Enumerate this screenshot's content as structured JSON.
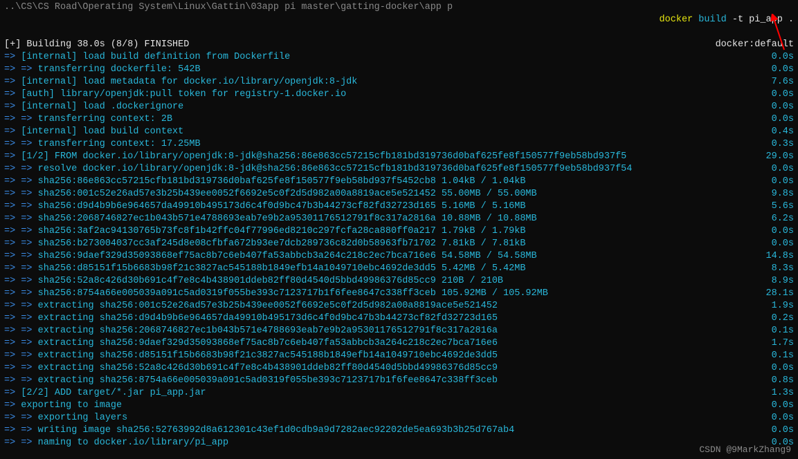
{
  "topbar": {
    "path": "..\\CS\\CS Road\\Operating System\\Linux\\Gattin\\03app pi master\\gatting-docker\\app p",
    "cmd_prefix": " docker ",
    "cmd_build": "build",
    "cmd_suffix": " -t pi_app ."
  },
  "header": {
    "building": "[+] Building 38.0s (8/8) FINISHED",
    "driver": "docker:default"
  },
  "rows": [
    {
      "prefix": "=>",
      "text": " [internal] load build definition from Dockerfile",
      "time": "0.0s"
    },
    {
      "prefix": "=> =>",
      "text": " transferring dockerfile: 542B",
      "time": "0.0s"
    },
    {
      "prefix": "=>",
      "text": " [internal] load metadata for docker.io/library/openjdk:8-jdk",
      "time": "7.6s"
    },
    {
      "prefix": "=>",
      "text": " [auth] library/openjdk:pull token for registry-1.docker.io",
      "time": "0.0s"
    },
    {
      "prefix": "=>",
      "text": " [internal] load .dockerignore",
      "time": "0.0s"
    },
    {
      "prefix": "=> =>",
      "text": " transferring context: 2B",
      "time": "0.0s"
    },
    {
      "prefix": "=>",
      "text": " [internal] load build context",
      "time": "0.4s"
    },
    {
      "prefix": "=> =>",
      "text": " transferring context: 17.25MB",
      "time": "0.3s"
    },
    {
      "prefix": "=>",
      "text": " [1/2] FROM docker.io/library/openjdk:8-jdk@sha256:86e863cc57215cfb181bd319736d0baf625fe8f150577f9eb58bd937f5",
      "time": "29.0s"
    },
    {
      "prefix": "=> =>",
      "text": " resolve docker.io/library/openjdk:8-jdk@sha256:86e863cc57215cfb181bd319736d0baf625fe8f150577f9eb58bd937f54",
      "time": "0.0s"
    },
    {
      "prefix": "=> =>",
      "text": " sha256:86e863cc57215cfb181bd319736d0baf625fe8f150577f9eb58bd937f5452cb8 1.04kB / 1.04kB",
      "time": "0.0s"
    },
    {
      "prefix": "=> =>",
      "text": " sha256:001c52e26ad57e3b25b439ee0052f6692e5c0f2d5d982a00a8819ace5e521452 55.00MB / 55.00MB",
      "time": "9.8s"
    },
    {
      "prefix": "=> =>",
      "text": " sha256:d9d4b9b6e964657da49910b495173d6c4f0d9bc47b3b44273cf82fd32723d165 5.16MB / 5.16MB",
      "time": "5.6s"
    },
    {
      "prefix": "=> =>",
      "text": " sha256:2068746827ec1b043b571e4788693eab7e9b2a95301176512791f8c317a2816a 10.88MB / 10.88MB",
      "time": "6.2s"
    },
    {
      "prefix": "=> =>",
      "text": " sha256:3af2ac94130765b73fc8f1b42ffc04f77996ed8210c297fcfa28ca880ff0a217 1.79kB / 1.79kB",
      "time": "0.0s"
    },
    {
      "prefix": "=> =>",
      "text": " sha256:b273004037cc3af245d8e08cfbfa672b93ee7dcb289736c82d0b58963fb71702 7.81kB / 7.81kB",
      "time": "0.0s"
    },
    {
      "prefix": "=> =>",
      "text": " sha256:9daef329d35093868ef75ac8b7c6eb407fa53abbcb3a264c218c2ec7bca716e6 54.58MB / 54.58MB",
      "time": "14.8s"
    },
    {
      "prefix": "=> =>",
      "text": " sha256:d85151f15b6683b98f21c3827ac545188b1849efb14a1049710ebc4692de3dd5 5.42MB / 5.42MB",
      "time": "8.3s"
    },
    {
      "prefix": "=> =>",
      "text": " sha256:52a8c426d30b691c4f7e8c4b438901ddeb82ff80d4540d5bbd49986376d85cc9 210B / 210B",
      "time": "8.9s"
    },
    {
      "prefix": "=> =>",
      "text": " sha256:8754a66e005039a091c5ad0319f055be393c7123717b1f6fee8647c338ff3ceb 105.92MB / 105.92MB",
      "time": "28.1s"
    },
    {
      "prefix": "=> =>",
      "text": " extracting sha256:001c52e26ad57e3b25b439ee0052f6692e5c0f2d5d982a00a8819ace5e521452",
      "time": "1.9s"
    },
    {
      "prefix": "=> =>",
      "text": " extracting sha256:d9d4b9b6e964657da49910b495173d6c4f0d9bc47b3b44273cf82fd32723d165",
      "time": "0.2s"
    },
    {
      "prefix": "=> =>",
      "text": " extracting sha256:2068746827ec1b043b571e4788693eab7e9b2a95301176512791f8c317a2816a",
      "time": "0.1s"
    },
    {
      "prefix": "=> =>",
      "text": " extracting sha256:9daef329d35093868ef75ac8b7c6eb407fa53abbcb3a264c218c2ec7bca716e6",
      "time": "1.7s"
    },
    {
      "prefix": "=> =>",
      "text": " extracting sha256:d85151f15b6683b98f21c3827ac545188b1849efb14a1049710ebc4692de3dd5",
      "time": "0.1s"
    },
    {
      "prefix": "=> =>",
      "text": " extracting sha256:52a8c426d30b691c4f7e8c4b438901ddeb82ff80d4540d5bbd49986376d85cc9",
      "time": "0.0s"
    },
    {
      "prefix": "=> =>",
      "text": " extracting sha256:8754a66e005039a091c5ad0319f055be393c7123717b1f6fee8647c338ff3ceb",
      "time": "0.8s"
    },
    {
      "prefix": "=>",
      "text": " [2/2] ADD target/*.jar pi_app.jar",
      "time": "1.3s"
    },
    {
      "prefix": "=>",
      "text": " exporting to image",
      "time": "0.0s"
    },
    {
      "prefix": "=> =>",
      "text": " exporting layers",
      "time": "0.0s"
    },
    {
      "prefix": "=> =>",
      "text": " writing image sha256:52763992d8a612301c43ef1d0cdb9a9d7282aec92202de5ea693b3b25d767ab4",
      "time": "0.0s"
    },
    {
      "prefix": "=> =>",
      "text": " naming to docker.io/library/pi_app",
      "time": "0.0s"
    }
  ],
  "watermark": "CSDN @9MarkZhang9"
}
